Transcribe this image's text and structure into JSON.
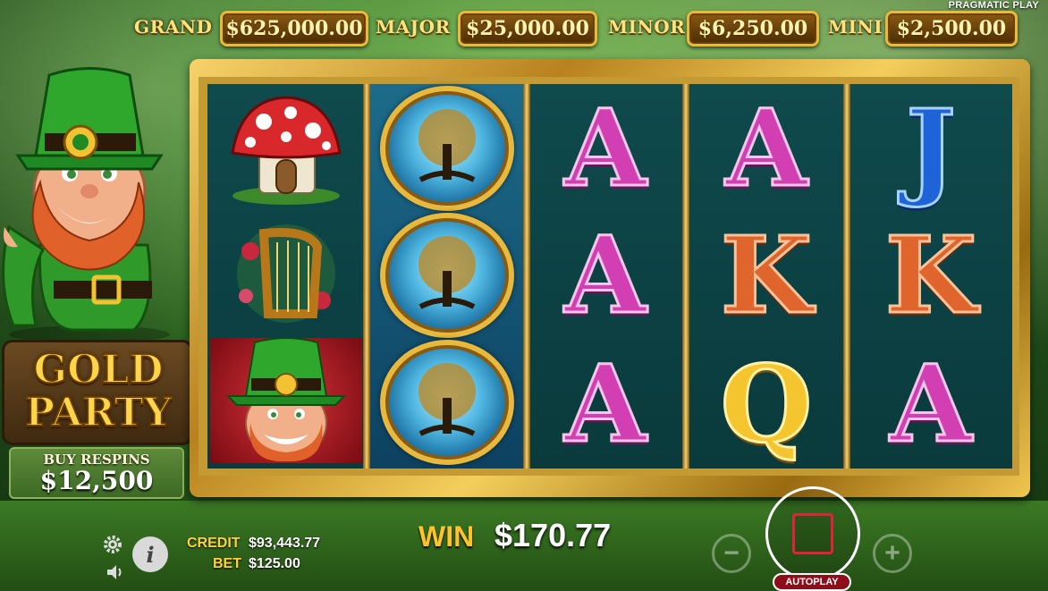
{
  "provider": "PRAGMATIC PLAY",
  "jackpots": [
    {
      "label": "GRAND",
      "amount": "$625,000.00"
    },
    {
      "label": "MAJOR",
      "amount": "$25,000.00"
    },
    {
      "label": "MINOR",
      "amount": "$6,250.00"
    },
    {
      "label": "MINI",
      "amount": "$2,500.00"
    }
  ],
  "logo": {
    "line1": "GOLD",
    "line2": "PARTY"
  },
  "buy_respins": {
    "title": "BUY RESPINS",
    "price": "$12,500"
  },
  "reels": [
    [
      "mushroom-house",
      "golden-harp",
      "leprechaun"
    ],
    [
      "tree-of-life",
      "tree-of-life",
      "tree-of-life"
    ],
    [
      "A",
      "A",
      "A"
    ],
    [
      "A",
      "K",
      "Q"
    ],
    [
      "J",
      "K",
      "A"
    ]
  ],
  "letters": {
    "r2": [
      "A",
      "A",
      "A"
    ],
    "r3": [
      "A",
      "K",
      "Q"
    ],
    "r4": [
      "J",
      "K",
      "A"
    ]
  },
  "colors": {
    "A": "#d23fb3",
    "K": "#e0652c",
    "Q": "#f4c52e",
    "J": "#1f63d8",
    "frame_gold": "#e9b938",
    "reel_bg": "#0f4a4d",
    "spin_accent": "#e0233a"
  },
  "bottom": {
    "credit_label": "CREDIT",
    "credit_value": "$93,443.77",
    "bet_label": "BET",
    "bet_value": "$125.00",
    "win_label": "WIN",
    "win_value": "$170.77"
  },
  "controls": {
    "autoplay_label": "AUTOPLAY",
    "minus": "−",
    "plus": "+",
    "info": "i"
  },
  "icons": [
    "gear-icon",
    "speaker-icon",
    "info-icon",
    "spin-icon"
  ]
}
